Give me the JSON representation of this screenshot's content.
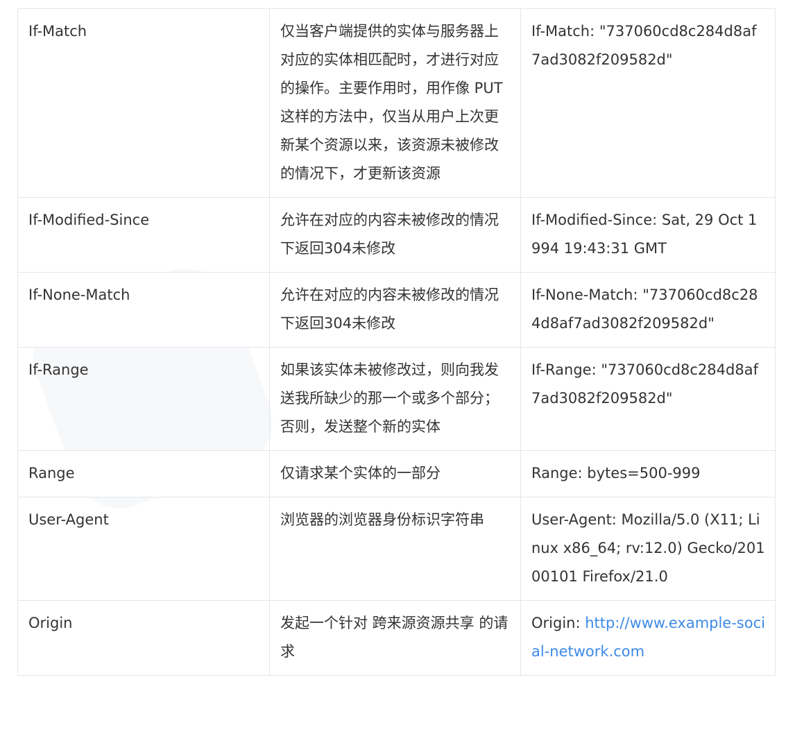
{
  "table": {
    "rows": [
      {
        "field": "If-Match",
        "description": "仅当客户端提供的实体与服务器上对应的实体相匹配时，才进行对应的操作。主要作用时，用作像 PUT 这样的方法中，仅当从用户上次更新某个资源以来，该资源未被修改的情况下，才更新该资源",
        "example": "If-Match: \"737060cd8c284d8af7ad3082f209582d\""
      },
      {
        "field": "If-Modified-Since",
        "description": "允许在对应的内容未被修改的情况下返回304未修改",
        "example": "If-Modified-Since: Sat, 29 Oct 1994 19:43:31 GMT"
      },
      {
        "field": "If-None-Match",
        "description": "允许在对应的内容未被修改的情况下返回304未修改",
        "example": "If-None-Match: \"737060cd8c284d8af7ad3082f209582d\""
      },
      {
        "field": "If-Range",
        "description": "如果该实体未被修改过，则向我发送我所缺少的那一个或多个部分；否则，发送整个新的实体",
        "example": "If-Range: \"737060cd8c284d8af7ad3082f209582d\""
      },
      {
        "field": "Range",
        "description": "仅请求某个实体的一部分",
        "example": "Range: bytes=500-999"
      },
      {
        "field": "User-Agent",
        "description": "浏览器的浏览器身份标识字符串",
        "example": "User-Agent: Mozilla/5.0 (X11; Linux x86_64; rv:12.0) Gecko/20100101 Firefox/21.0"
      },
      {
        "field": "Origin",
        "description": "发起一个针对 跨来源资源共享 的请求",
        "example_prefix": "Origin: ",
        "example_link": "http://www.example-social-network.com"
      }
    ]
  },
  "colors": {
    "text": "#333333",
    "border": "#e3e6ea",
    "link": "#3c8ae6"
  }
}
